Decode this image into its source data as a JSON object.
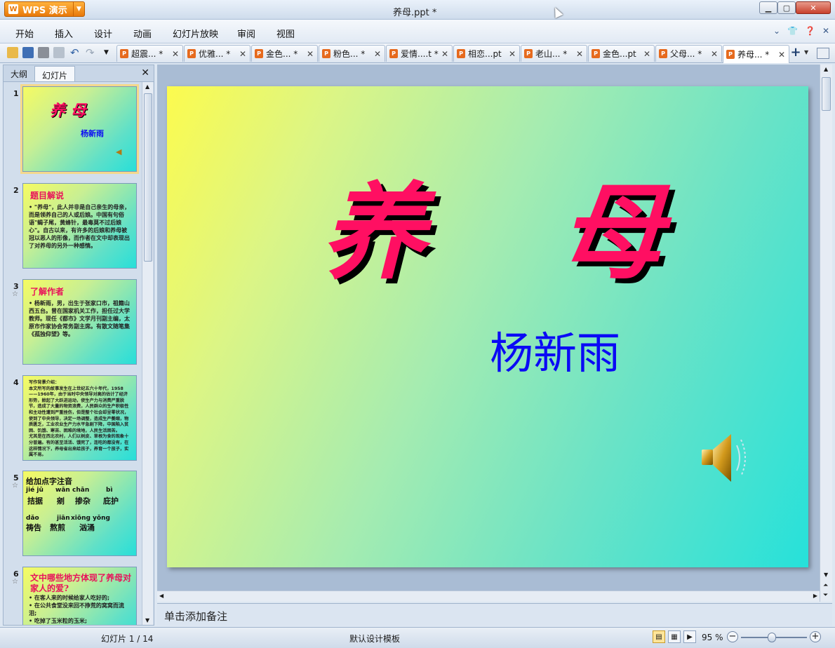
{
  "app": {
    "name": "WPS 演示",
    "window_title": "养母.ppt * "
  },
  "menu": [
    "开始",
    "插入",
    "设计",
    "动画",
    "幻灯片放映",
    "审阅",
    "视图"
  ],
  "doc_tabs": [
    {
      "label": "超震... *"
    },
    {
      "label": "优雅... *"
    },
    {
      "label": "金色... *"
    },
    {
      "label": "粉色... *"
    },
    {
      "label": "爱情....t *"
    },
    {
      "label": "相恋...pt"
    },
    {
      "label": "老山... *"
    },
    {
      "label": "金色...pt"
    },
    {
      "label": "父母... *"
    },
    {
      "label": "养母... *",
      "active": true
    }
  ],
  "panel": {
    "tabs": [
      "大纲",
      "幻灯片"
    ],
    "active_tab": "幻灯片"
  },
  "thumbnails": [
    {
      "num": "1",
      "title": "养 母",
      "subtitle": "杨新雨",
      "selected": true
    },
    {
      "num": "2",
      "title": "题目解说",
      "body": "• \"养母\"，此人并非是自己亲生的母亲，而是领养自己的人或后娘。中国有句俗语\"蝎子尾，黄蜂针，最毒莫不过后娘心\"。自古以来，有许多的后娘和养母被冠以恶人的形像，而作者在文中却表现出了对养母的另外一种感情。"
    },
    {
      "num": "3",
      "title": "了解作者",
      "body": "• 杨新雨，男，出生于张家口市，祖籍山西五台。曾在国家机关工作，担任过大学教师。现任《都市》文学月刊副主编，太原市作家协会常务副主席。有散文随笔集《孤独仰望》等。",
      "star": true
    },
    {
      "num": "4",
      "body": "写作背景介绍：\n本文所写的故事发生在上世纪五六十年代，1958——1960年，由于当时中央领导对高的估计了经济形势，掀起了大跃进运动，使生产力与消费严重脱节，造成了大量的物资浪费，人民群众的生产积极性和主动性遭到严重挫伤，但是整个社会却呈零状况，使到了中央领导，决定一场调整，造成生产萎缩，物质匮乏，工业农业生产力水平急剧下降，中国陷入贫困、饥饿、寒苦、困难的境地，人民生活困苦。\n尤其是在西北农村，人们以树皮、草根为食的现象十分普遍。有的甚至活活、饿死了，连吃的都没有，在这样情况下，养母省出来给孩子，养育一个孩子，实属不易。"
    },
    {
      "num": "5",
      "title": "给加点字注音",
      "star": true
    },
    {
      "num": "6",
      "title": "文中哪些地方体现了养母对家人的爱?",
      "body": "• 在客人来的时候给家人吃好的;\n• 在公共食堂没来回不挣荒的窝窝而流泪;\n• 吃掉了玉米粒的玉米;\n  等待孩子们的亲自己等人...",
      "star": true
    }
  ],
  "pinyin_slide": {
    "title": "给加点字注音",
    "row1_pinyin": [
      "jié jū",
      "wān",
      "chān",
      "bì"
    ],
    "row1_words": [
      "拮据",
      "剜",
      "掺杂",
      "庇护"
    ],
    "row2_pinyin": [
      "dǎo",
      "jiān",
      "xiōng yǒng"
    ],
    "row2_words": [
      "祷告",
      "熬煎",
      "汹涌"
    ]
  },
  "slide": {
    "title": "养 母",
    "author": "杨新雨"
  },
  "notes_placeholder": "单击添加备注",
  "status": {
    "slide_info": "幻灯片 1 / 14",
    "template": "默认设计模板",
    "zoom": "95 %"
  },
  "colors": {
    "title_pink": "#ff0f62",
    "author_blue": "#0a0af5",
    "thumb_title_red": "#e8125b",
    "wps_orange": "#e8790a"
  },
  "icons": [
    "open-icon",
    "save-icon",
    "print-icon",
    "print-preview-icon",
    "undo-icon",
    "redo-icon",
    "speaker-icon"
  ]
}
